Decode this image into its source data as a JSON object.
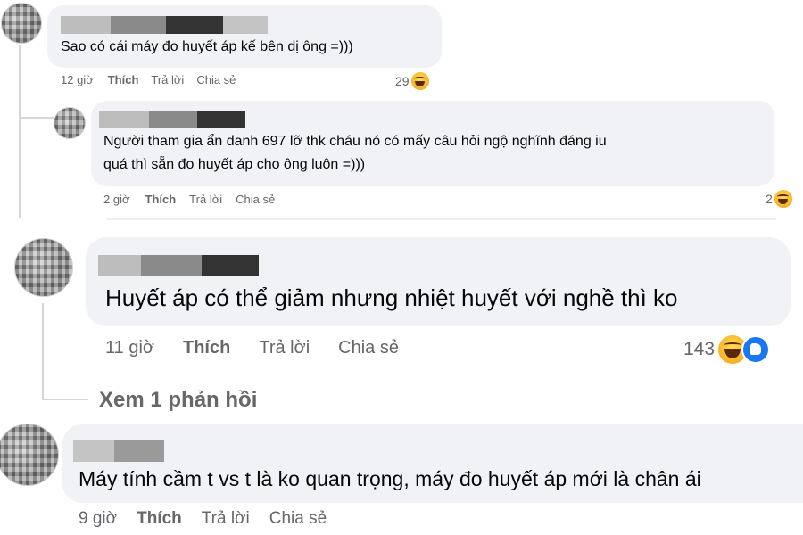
{
  "comments": [
    {
      "text": "Sao có cái máy đo huyết áp kế bên dị ông =)))",
      "time": "12 giờ",
      "like_label": "Thích",
      "reply_label": "Trả lời",
      "share_label": "Chia sẻ",
      "reaction_count": "29",
      "reactions": [
        "haha-icon"
      ]
    },
    {
      "text_line1": "Người tham gia ẩn danh 697 lỡ thk cháu nó có mấy câu hỏi ngộ nghĩnh đáng iu",
      "text_line2": "quá thì sẵn đo huyết áp cho ông luôn =)))",
      "time": "2 giờ",
      "like_label": "Thích",
      "reply_label": "Trả lời",
      "share_label": "Chia sẻ",
      "reaction_count": "2",
      "reactions": [
        "haha-icon"
      ]
    },
    {
      "text": "Huyết áp có thể giảm nhưng nhiệt huyết với nghề thì ko",
      "time": "11 giờ",
      "like_label": "Thích",
      "reply_label": "Trả lời",
      "share_label": "Chia sẻ",
      "reaction_count": "143",
      "reactions": [
        "haha-icon",
        "like-icon"
      ]
    },
    {
      "text": "Máy tính cầm t vs t là ko quan trọng, máy đo huyết áp mới là chân ái",
      "time": "9 giờ",
      "like_label": "Thích",
      "reply_label": "Trả lời",
      "share_label": "Chia sẻ"
    }
  ],
  "view_replies_label": "Xem 1 phản hồi",
  "colors": {
    "bubble": "#f0f2f5",
    "meta_text": "#65676b",
    "like_blue": "#1877f2",
    "haha_yellow": "#f7b125"
  }
}
